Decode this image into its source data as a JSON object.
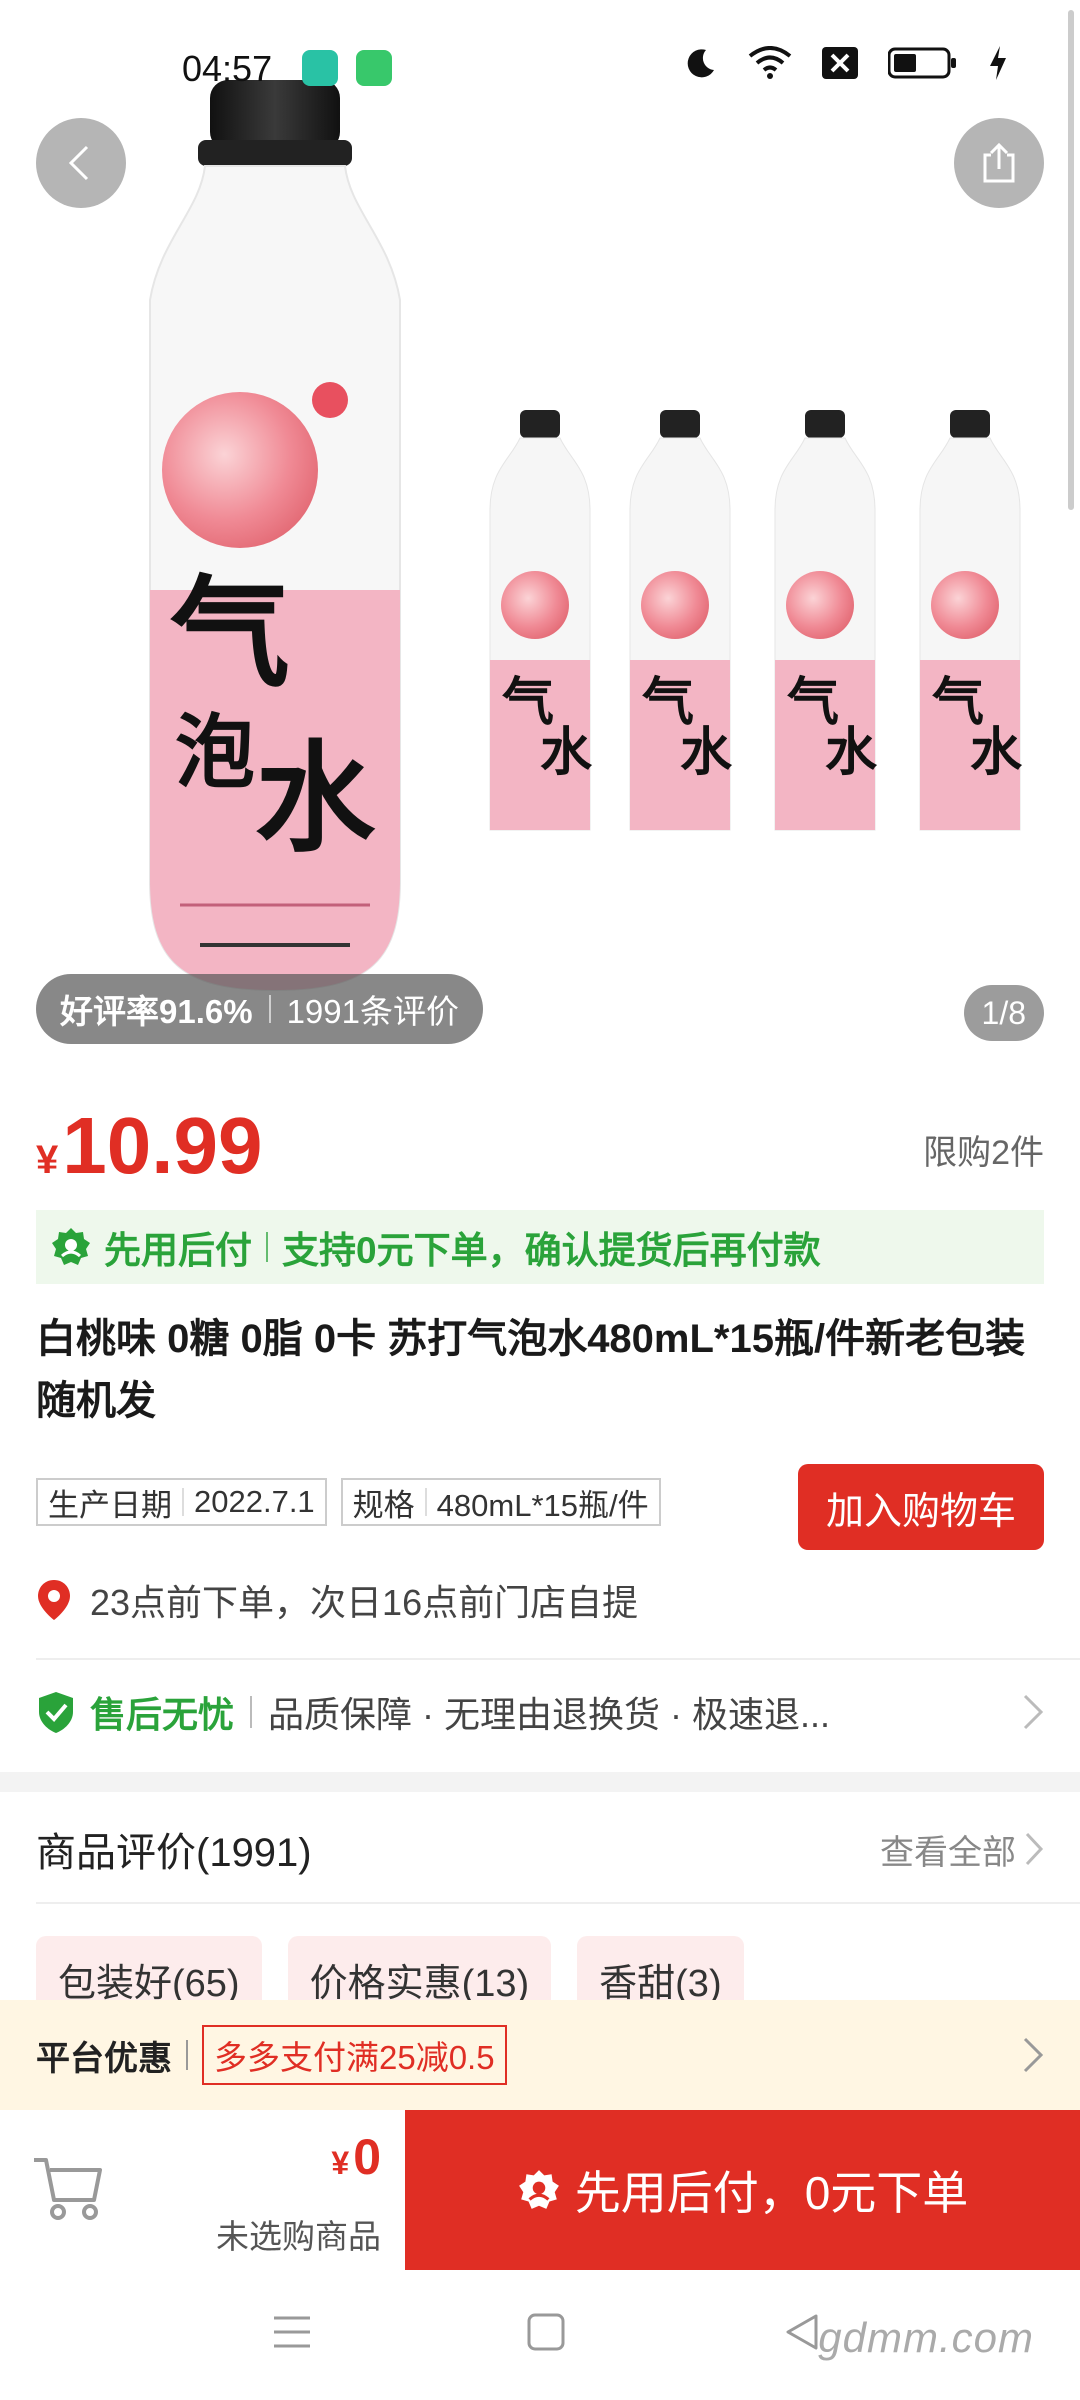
{
  "status_bar": {
    "time": "04:57"
  },
  "gallery": {
    "rating_rate": "好评率91.6%",
    "rating_count": "1991条评价",
    "page_indicator": "1/8"
  },
  "product": {
    "currency": "¥",
    "price": "10.99",
    "limit": "限购2件",
    "pay_later_label": "先用后付",
    "pay_later_desc": "支持0元下单，确认提货后再付款",
    "title": "白桃味 0糖 0脂 0卡 苏打气泡水480mL*15瓶/件新老包装随机发",
    "specs": [
      {
        "label": "生产日期",
        "value": "2022.7.1"
      },
      {
        "label": "规格",
        "value": "480mL*15瓶/件"
      }
    ],
    "add_to_cart": "加入购物车",
    "pickup": "23点前下单，次日16点前门店自提",
    "service_label": "售后无忧",
    "service_items": "品质保障 · 无理由退换货 · 极速退..."
  },
  "reviews": {
    "title": "商品评价(1991)",
    "view_all": "查看全部",
    "tags": [
      "包装好(65)",
      "价格实惠(13)",
      "香甜(3)"
    ]
  },
  "promo": {
    "label": "平台优惠",
    "coupon": "多多支付满25减0.5"
  },
  "bottom_bar": {
    "currency": "¥",
    "total": "0",
    "empty_text": "未选购商品",
    "buy_button": "先用后付，0元下单"
  },
  "watermark": "gdmm.com",
  "colors": {
    "brand_red": "#e02e24",
    "green": "#2aa33a",
    "pink": "#f2b8c6"
  }
}
